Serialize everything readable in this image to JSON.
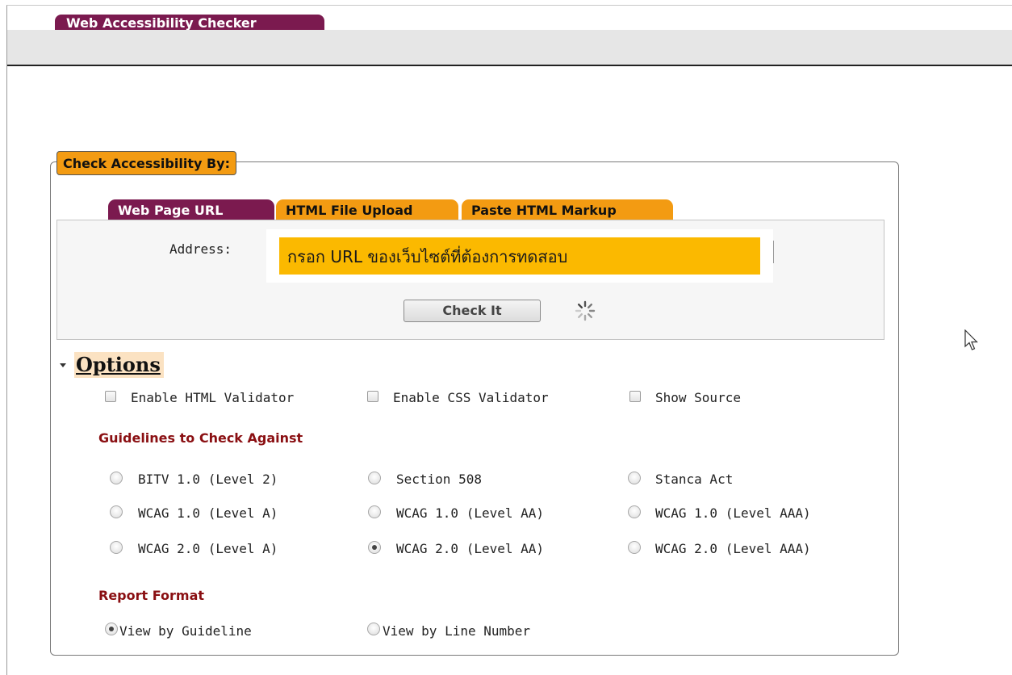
{
  "app": {
    "title": "Web Accessibility Checker"
  },
  "form": {
    "legend": "Check Accessibility By:",
    "tabs": [
      {
        "label": "Web Page URL",
        "active": true
      },
      {
        "label": "HTML File Upload",
        "active": false
      },
      {
        "label": "Paste HTML Markup",
        "active": false
      }
    ],
    "address_label": "Address:",
    "address_value": "กรอก URL ของเว็บไซต์ที่ต้องการทดสอบ",
    "check_button": "Check It"
  },
  "options": {
    "title": "Options",
    "checkboxes": [
      {
        "label": "Enable HTML Validator",
        "checked": false
      },
      {
        "label": "Enable CSS Validator",
        "checked": false
      },
      {
        "label": "Show Source",
        "checked": false
      }
    ],
    "guidelines_heading": "Guidelines to Check Against",
    "guidelines": [
      {
        "label": "BITV 1.0 (Level 2)",
        "checked": false
      },
      {
        "label": "Section 508",
        "checked": false
      },
      {
        "label": "Stanca Act",
        "checked": false
      },
      {
        "label": "WCAG 1.0 (Level A)",
        "checked": false
      },
      {
        "label": "WCAG 1.0 (Level AA)",
        "checked": false
      },
      {
        "label": "WCAG 1.0 (Level AAA)",
        "checked": false
      },
      {
        "label": "WCAG 2.0 (Level A)",
        "checked": false
      },
      {
        "label": "WCAG 2.0 (Level AA)",
        "checked": true
      },
      {
        "label": "WCAG 2.0 (Level AAA)",
        "checked": false
      }
    ],
    "report_heading": "Report Format",
    "report_formats": [
      {
        "label": "View by Guideline",
        "checked": true
      },
      {
        "label": "View by Line Number",
        "checked": false
      }
    ]
  },
  "colors": {
    "brand_tab": "#7b1a4f",
    "accent_orange": "#f39b12",
    "input_highlight": "#fbb900",
    "heading_red": "#8a0f12"
  },
  "icons": [
    "loading-spinner-icon",
    "mouse-pointer-icon",
    "collapse-arrow-icon"
  ]
}
